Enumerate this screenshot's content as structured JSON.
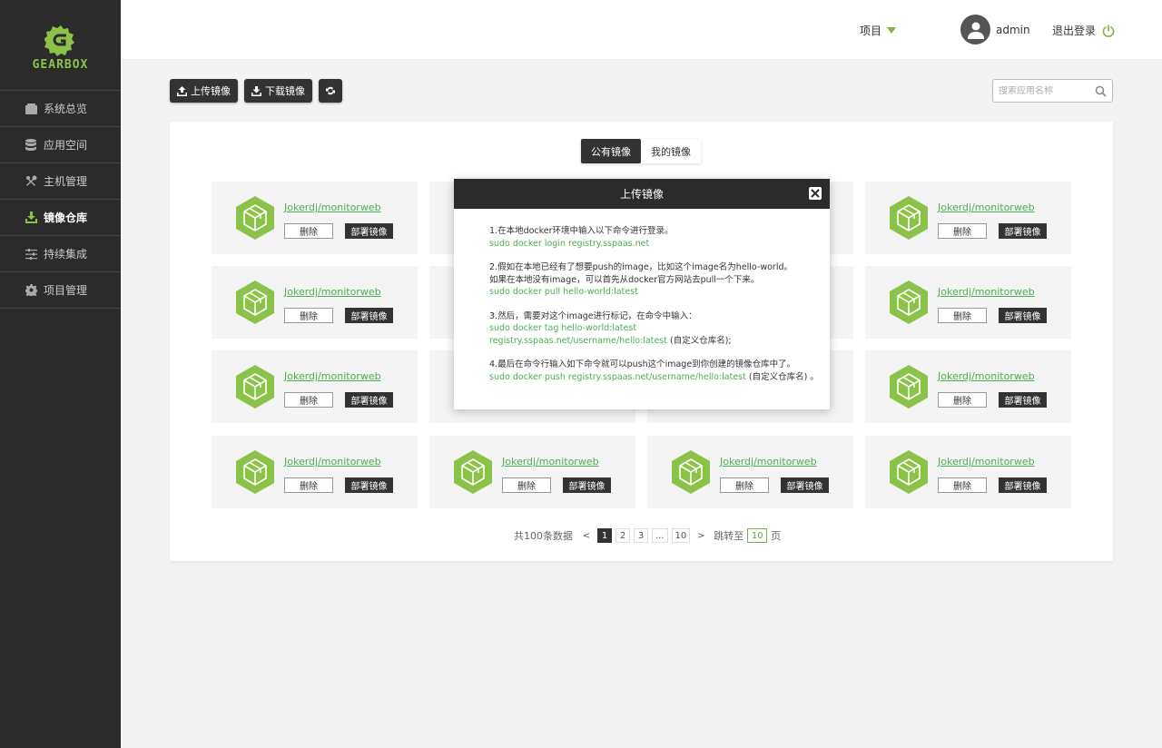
{
  "sidebar": {
    "logo_text": "GEARBOX",
    "items": [
      {
        "label": "系统总览",
        "icon": "wallet-icon"
      },
      {
        "label": "应用空间",
        "icon": "database-icon"
      },
      {
        "label": "主机管理",
        "icon": "tools-icon"
      },
      {
        "label": "镜像仓库",
        "icon": "download-box-icon"
      },
      {
        "label": "持续集成",
        "icon": "sliders-icon"
      },
      {
        "label": "项目管理",
        "icon": "gear-icon"
      }
    ],
    "active_index": 3
  },
  "header": {
    "project_menu": "项目",
    "username": "admin",
    "logout": "退出登录"
  },
  "toolbar": {
    "upload_label": "上传镜像",
    "download_label": "下载镜像",
    "search_placeholder": "搜索应用名称"
  },
  "tabs": {
    "public": "公有镜像",
    "mine": "我的镜像"
  },
  "card_labels": {
    "title": "Jokerdj/monitorweb",
    "delete": "删除",
    "deploy": "部署镜像"
  },
  "cards_visible": [
    {
      "row": 0,
      "col": 0,
      "title": "Jokerdj/monitorweb",
      "delete": "删除",
      "deploy": "部署镜像"
    },
    {
      "row": 0,
      "col": 3,
      "title": "Jokerdj/monitorweb",
      "delete": "删除",
      "deploy": "部署镜像"
    },
    {
      "row": 1,
      "col": 0,
      "title": "Jokerdj/monitorweb",
      "delete": "删除",
      "deploy": "部署镜像"
    },
    {
      "row": 1,
      "col": 3,
      "title": "Jokerdj/monitorweb",
      "delete": "删除",
      "deploy": "部署镜像"
    },
    {
      "row": 2,
      "col": 0,
      "title": "Jokerdj/monitorweb",
      "delete": "删除",
      "deploy": "部署镜像"
    },
    {
      "row": 2,
      "col": 3,
      "title": "Jokerdj/monitorweb",
      "delete": "删除",
      "deploy": "部署镜像"
    },
    {
      "row": 3,
      "col": 0,
      "title": "Jokerdj/monitorweb",
      "delete": "删除",
      "deploy": "部署镜像"
    },
    {
      "row": 3,
      "col": 1,
      "title": "Jokerdj/monitorweb",
      "delete": "删除",
      "deploy": "部署镜像"
    },
    {
      "row": 3,
      "col": 2,
      "title": "Jokerdj/monitorweb",
      "delete": "删除",
      "deploy": "部署镜像"
    },
    {
      "row": 3,
      "col": 3,
      "title": "Jokerdj/monitorweb",
      "delete": "删除",
      "deploy": "部署镜像"
    }
  ],
  "pagination": {
    "total_text": "共100条数据",
    "prev": "<",
    "pages": [
      "1",
      "2",
      "3",
      "...",
      "10"
    ],
    "current": "1",
    "next": ">",
    "jump_label": "跳转至",
    "jump_value": "10",
    "page_suffix": "页"
  },
  "modal": {
    "title": "上传镜像",
    "step1_text": "1.在本地docker环境中输入以下命令进行登录。",
    "step1_cmd": "sudo docker login registry.sspaas.net",
    "step2_text_a": "2.假如在本地已经有了想要push的image，比如这个image名为hello-world。",
    "step2_text_b": "如果在本地没有image，可以首先从docker官方网站去pull一个下来。",
    "step2_cmd": "sudo docker pull hello-world:latest",
    "step3_text": "3.然后，需要对这个image进行标记，在命令中输入：",
    "step3_cmd_a": "sudo docker tag hello-world:latest",
    "step3_cmd_b": "registry.sspaas.net/username/hello:latest",
    "step3_note": " (自定义仓库名);",
    "step4_text": "4.最后在命令行输入如下命令就可以push这个image到你创建的镜像仓库中了。",
    "step4_cmd": "sudo docker push registry.sspaas.net/username/hello:latest",
    "step4_note": " (自定义仓库名) 。"
  },
  "colors": {
    "accent": "#7cb342",
    "link": "#4caf50",
    "dark": "#333333",
    "sidebar": "#2b2b2b"
  }
}
